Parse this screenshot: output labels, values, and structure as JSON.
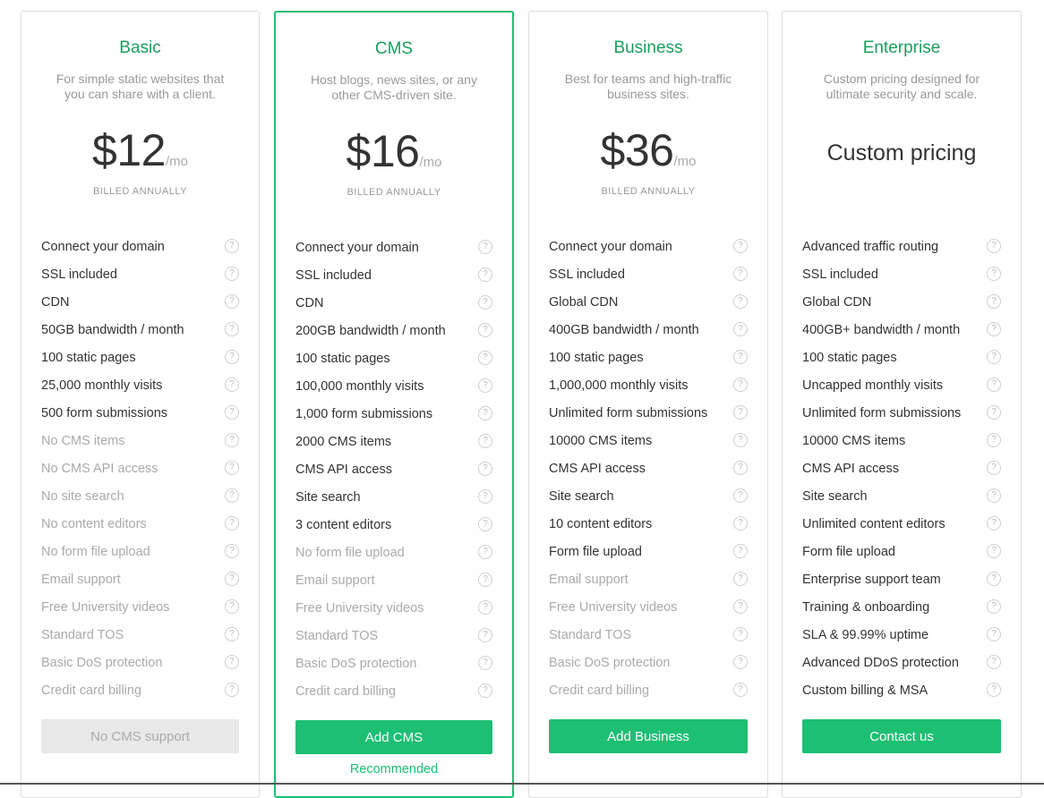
{
  "plans": [
    {
      "name": "Basic",
      "description": "For simple static websites that you can share with a client.",
      "price_amount": "$12",
      "price_unit": "/mo",
      "custom_price": "",
      "billing": "BILLED ANNUALLY",
      "features": [
        {
          "label": "Connect your domain",
          "included": true
        },
        {
          "label": "SSL included",
          "included": true
        },
        {
          "label": "CDN",
          "included": true
        },
        {
          "label": "50GB bandwidth / month",
          "included": true
        },
        {
          "label": "100 static pages",
          "included": true
        },
        {
          "label": "25,000 monthly visits",
          "included": true
        },
        {
          "label": "500 form submissions",
          "included": true
        },
        {
          "label": "No CMS items",
          "included": false
        },
        {
          "label": "No CMS API access",
          "included": false
        },
        {
          "label": "No site search",
          "included": false
        },
        {
          "label": "No content editors",
          "included": false
        },
        {
          "label": "No form file upload",
          "included": false
        },
        {
          "label": "Email support",
          "included": false
        },
        {
          "label": "Free University videos",
          "included": false
        },
        {
          "label": "Standard TOS",
          "included": false
        },
        {
          "label": "Basic DoS protection",
          "included": false
        },
        {
          "label": "Credit card billing",
          "included": false
        }
      ],
      "cta_label": "No CMS support",
      "cta_enabled": false,
      "footer_note": ""
    },
    {
      "name": "CMS",
      "description": "Host blogs, news sites, or any other CMS-driven site.",
      "price_amount": "$16",
      "price_unit": "/mo",
      "custom_price": "",
      "billing": "BILLED ANNUALLY",
      "features": [
        {
          "label": "Connect your domain",
          "included": true
        },
        {
          "label": "SSL included",
          "included": true
        },
        {
          "label": "CDN",
          "included": true
        },
        {
          "label": "200GB bandwidth / month",
          "included": true
        },
        {
          "label": "100 static pages",
          "included": true
        },
        {
          "label": "100,000 monthly visits",
          "included": true
        },
        {
          "label": "1,000 form submissions",
          "included": true
        },
        {
          "label": "2000 CMS items",
          "included": true
        },
        {
          "label": "CMS API access",
          "included": true
        },
        {
          "label": "Site search",
          "included": true
        },
        {
          "label": "3 content editors",
          "included": true
        },
        {
          "label": "No form file upload",
          "included": false
        },
        {
          "label": "Email support",
          "included": false
        },
        {
          "label": "Free University videos",
          "included": false
        },
        {
          "label": "Standard TOS",
          "included": false
        },
        {
          "label": "Basic DoS protection",
          "included": false
        },
        {
          "label": "Credit card billing",
          "included": false
        }
      ],
      "cta_label": "Add CMS",
      "cta_enabled": true,
      "footer_note": "Recommended"
    },
    {
      "name": "Business",
      "description": "Best for teams and high-traffic business sites.",
      "price_amount": "$36",
      "price_unit": "/mo",
      "custom_price": "",
      "billing": "BILLED ANNUALLY",
      "features": [
        {
          "label": "Connect your domain",
          "included": true
        },
        {
          "label": "SSL included",
          "included": true
        },
        {
          "label": "Global CDN",
          "included": true
        },
        {
          "label": "400GB bandwidth / month",
          "included": true
        },
        {
          "label": "100 static pages",
          "included": true
        },
        {
          "label": "1,000,000 monthly visits",
          "included": true
        },
        {
          "label": "Unlimited form submissions",
          "included": true
        },
        {
          "label": "10000 CMS items",
          "included": true
        },
        {
          "label": "CMS API access",
          "included": true
        },
        {
          "label": "Site search",
          "included": true
        },
        {
          "label": "10 content editors",
          "included": true
        },
        {
          "label": "Form file upload",
          "included": true
        },
        {
          "label": "Email support",
          "included": false
        },
        {
          "label": "Free University videos",
          "included": false
        },
        {
          "label": "Standard TOS",
          "included": false
        },
        {
          "label": "Basic DoS protection",
          "included": false
        },
        {
          "label": "Credit card billing",
          "included": false
        }
      ],
      "cta_label": "Add Business",
      "cta_enabled": true,
      "footer_note": ""
    },
    {
      "name": "Enterprise",
      "description": "Custom pricing designed for ultimate security and scale.",
      "price_amount": "",
      "price_unit": "",
      "custom_price": "Custom pricing",
      "billing": "",
      "features": [
        {
          "label": "Advanced traffic routing",
          "included": true
        },
        {
          "label": "SSL included",
          "included": true
        },
        {
          "label": "Global CDN",
          "included": true
        },
        {
          "label": "400GB+ bandwidth / month",
          "included": true
        },
        {
          "label": "100 static pages",
          "included": true
        },
        {
          "label": "Uncapped monthly visits",
          "included": true
        },
        {
          "label": "Unlimited form submissions",
          "included": true
        },
        {
          "label": "10000 CMS items",
          "included": true
        },
        {
          "label": "CMS API access",
          "included": true
        },
        {
          "label": "Site search",
          "included": true
        },
        {
          "label": "Unlimited content editors",
          "included": true
        },
        {
          "label": "Form file upload",
          "included": true
        },
        {
          "label": "Enterprise support team",
          "included": true
        },
        {
          "label": "Training & onboarding",
          "included": true
        },
        {
          "label": "SLA & 99.99% uptime",
          "included": true
        },
        {
          "label": "Advanced DDoS protection",
          "included": true
        },
        {
          "label": "Custom billing & MSA",
          "included": true
        }
      ],
      "cta_label": "Contact us",
      "cta_enabled": true,
      "footer_note": ""
    }
  ],
  "help_icon": {
    "name": "question-circle-icon",
    "glyph": "?"
  },
  "colors": {
    "accent": "#1dbf73",
    "title": "#1a9e5d",
    "muted": "#aaaaaa",
    "border": "#dddddd"
  }
}
